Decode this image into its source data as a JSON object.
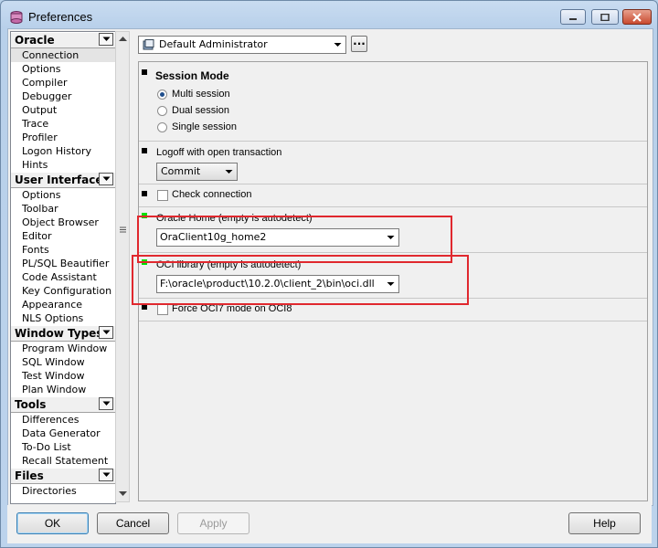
{
  "window": {
    "title": "Preferences"
  },
  "sidebar": {
    "groups": [
      {
        "title": "Oracle",
        "items": [
          "Connection",
          "Options",
          "Compiler",
          "Debugger",
          "Output",
          "Trace",
          "Profiler",
          "Logon History",
          "Hints"
        ]
      },
      {
        "title": "User Interface",
        "items": [
          "Options",
          "Toolbar",
          "Object Browser",
          "Editor",
          "Fonts",
          "PL/SQL Beautifier",
          "Code Assistant",
          "Key Configuration",
          "Appearance",
          "NLS Options"
        ]
      },
      {
        "title": "Window Types",
        "items": [
          "Program Window",
          "SQL Window",
          "Test Window",
          "Plan Window"
        ]
      },
      {
        "title": "Tools",
        "items": [
          "Differences",
          "Data Generator",
          "To-Do List",
          "Recall Statement"
        ]
      },
      {
        "title": "Files",
        "items": [
          "Directories"
        ]
      }
    ],
    "selected_item": "Connection"
  },
  "profile": {
    "value": "Default Administrator",
    "more_label": "..."
  },
  "session_mode": {
    "title": "Session Mode",
    "options": [
      "Multi session",
      "Dual session",
      "Single session"
    ],
    "selected": "Multi session"
  },
  "logoff": {
    "label": "Logoff with open transaction",
    "value": "Commit"
  },
  "check_connection": {
    "label": "Check connection",
    "checked": false
  },
  "oracle_home": {
    "label": "Oracle Home (empty is autodetect)",
    "value": "OraClient10g_home2"
  },
  "oci_library": {
    "label": "OCI library (empty is autodetect)",
    "value": "F:\\oracle\\product\\10.2.0\\client_2\\bin\\oci.dll"
  },
  "force_oci7": {
    "label": "Force OCI7 mode on OCI8",
    "checked": false
  },
  "buttons": {
    "ok": "OK",
    "cancel": "Cancel",
    "apply": "Apply",
    "help": "Help"
  },
  "colors": {
    "highlight_box": "#e0282e",
    "changed_marker": "#00e000"
  }
}
